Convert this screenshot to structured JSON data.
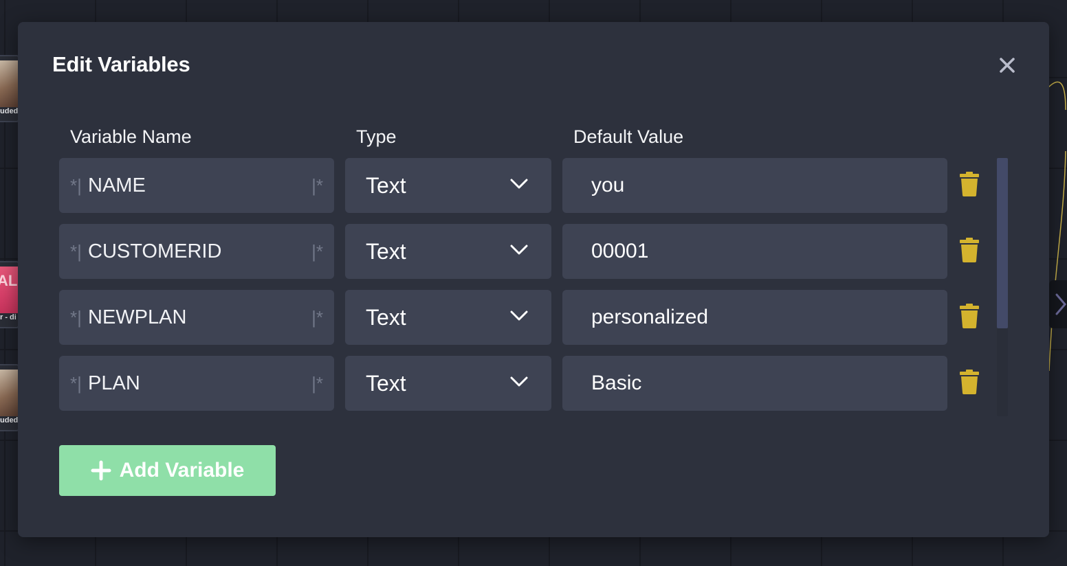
{
  "background": {
    "node_captions": [
      "uded",
      "r - di",
      "uded"
    ],
    "sale_text": "ALE"
  },
  "modal": {
    "title": "Edit Variables",
    "close_icon": "close-icon"
  },
  "columns": {
    "name": "Variable Name",
    "type": "Type",
    "default": "Default Value"
  },
  "delimiters": {
    "open": "*|",
    "close": "|*"
  },
  "variables": [
    {
      "name": "NAME",
      "type": "Text",
      "default_value": "you"
    },
    {
      "name": "CUSTOMERID",
      "type": "Text",
      "default_value": "00001"
    },
    {
      "name": "NEWPLAN",
      "type": "Text",
      "default_value": "personalized"
    },
    {
      "name": "PLAN",
      "type": "Text",
      "default_value": "Basic"
    }
  ],
  "add_button": {
    "label": "Add Variable",
    "icon": "plus-icon"
  },
  "colors": {
    "modal_bg": "#2d313d",
    "field_bg": "#3e4353",
    "trash_accent": "#d4b32e",
    "add_button_bg": "#8fdfa8"
  }
}
